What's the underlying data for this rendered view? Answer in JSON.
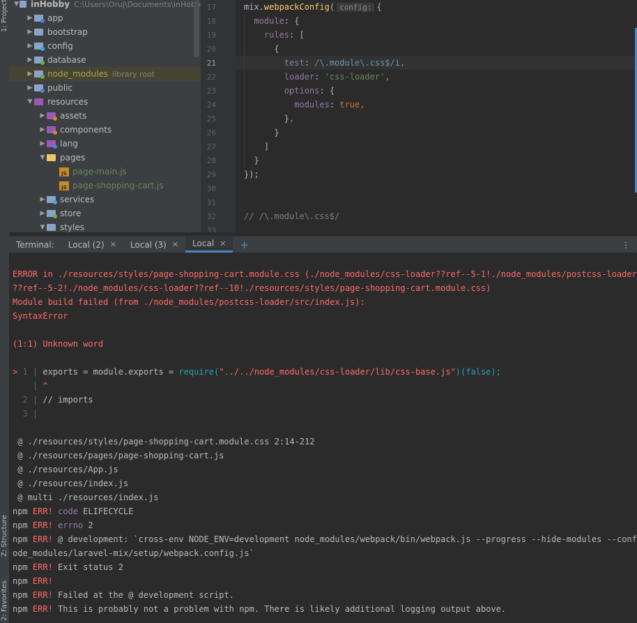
{
  "side_tabs": {
    "project": "1: Project",
    "structure": "Z: Structure",
    "favorites": "2: Favorites"
  },
  "project_tree": [
    {
      "label": "inHobby",
      "path": "C:\\Users\\Oruj\\Documents\\inHobb",
      "level": 0,
      "arrow": "down",
      "type": "root"
    },
    {
      "label": "app",
      "level": 1,
      "arrow": "right",
      "type": "folder"
    },
    {
      "label": "bootstrap",
      "level": 1,
      "arrow": "right",
      "type": "folder"
    },
    {
      "label": "config",
      "level": 1,
      "arrow": "right",
      "type": "folder"
    },
    {
      "label": "database",
      "level": 1,
      "arrow": "right",
      "type": "folder"
    },
    {
      "label": "node_modules",
      "extra": "library root",
      "level": 1,
      "arrow": "right",
      "type": "folder",
      "highlight": true
    },
    {
      "label": "public",
      "level": 1,
      "arrow": "right",
      "type": "folder"
    },
    {
      "label": "resources",
      "level": 1,
      "arrow": "down",
      "type": "folder"
    },
    {
      "label": "assets",
      "level": 2,
      "arrow": "right",
      "type": "folder"
    },
    {
      "label": "components",
      "level": 2,
      "arrow": "right",
      "type": "folder"
    },
    {
      "label": "lang",
      "level": 2,
      "arrow": "right",
      "type": "folder"
    },
    {
      "label": "pages",
      "level": 2,
      "arrow": "down",
      "type": "folder"
    },
    {
      "label": "page-main.js",
      "level": 3,
      "arrow": "",
      "type": "js"
    },
    {
      "label": "page-shopping-cart.js",
      "level": 3,
      "arrow": "",
      "type": "js"
    },
    {
      "label": "services",
      "level": 2,
      "arrow": "right",
      "type": "folder"
    },
    {
      "label": "store",
      "level": 2,
      "arrow": "right",
      "type": "folder"
    },
    {
      "label": "styles",
      "level": 2,
      "arrow": "down",
      "type": "folder"
    }
  ],
  "editor": {
    "line_numbers": [
      "17",
      "18",
      "19",
      "20",
      "21",
      "22",
      "23",
      "24",
      "25",
      "26",
      "27",
      "28",
      "29",
      "30",
      "31",
      "32",
      "33"
    ],
    "param_hint": "config:",
    "lines": [
      [
        {
          "t": "mix.",
          "c": "pl"
        },
        {
          "t": "webpackConfig",
          "c": "fn"
        },
        {
          "t": "(",
          "c": "pl"
        },
        {
          "t": "config:",
          "c": "hint"
        },
        {
          "t": "{",
          "c": "pl"
        }
      ],
      [
        {
          "t": "  module",
          "c": "prop"
        },
        {
          "t": ": {",
          "c": "pl"
        }
      ],
      [
        {
          "t": "    rules",
          "c": "prop"
        },
        {
          "t": ": [",
          "c": "pl"
        }
      ],
      [
        {
          "t": "      {",
          "c": "pl"
        }
      ],
      [
        {
          "t": "        test",
          "c": "prop"
        },
        {
          "t": ": ",
          "c": "pl"
        },
        {
          "t": "/\\.module\\.css$/i",
          "c": "rx"
        },
        {
          "t": ",",
          "c": "kw"
        }
      ],
      [
        {
          "t": "        loader",
          "c": "prop"
        },
        {
          "t": ": ",
          "c": "pl"
        },
        {
          "t": "'css-loader'",
          "c": "str"
        },
        {
          "t": ",",
          "c": "kw"
        }
      ],
      [
        {
          "t": "        options",
          "c": "prop"
        },
        {
          "t": ": {",
          "c": "pl"
        }
      ],
      [
        {
          "t": "          modules",
          "c": "prop"
        },
        {
          "t": ": ",
          "c": "pl"
        },
        {
          "t": "true",
          "c": "kw"
        },
        {
          "t": ",",
          "c": "kw"
        }
      ],
      [
        {
          "t": "        }",
          "c": "pl"
        },
        {
          "t": ",",
          "c": "kw"
        }
      ],
      [
        {
          "t": "      }",
          "c": "pl"
        }
      ],
      [
        {
          "t": "    ]",
          "c": "pl"
        }
      ],
      [
        {
          "t": "  }",
          "c": "pl"
        }
      ],
      [
        {
          "t": "});",
          "c": "pl"
        }
      ],
      [],
      [],
      [
        {
          "t": "// /\\.module\\.css$/",
          "c": "cm"
        }
      ],
      []
    ]
  },
  "terminal": {
    "label": "Terminal:",
    "tabs": [
      {
        "label": "Local (2)",
        "active": false
      },
      {
        "label": "Local (3)",
        "active": false
      },
      {
        "label": "Local",
        "active": true
      }
    ],
    "add": "+",
    "menu": "⋮",
    "lines": [
      {
        "text": "",
        "c": ""
      },
      {
        "text": "ERROR in ./resources/styles/page-shopping-cart.module.css (./node_modules/css-loader??ref--5-1!./node_modules/postcss-loader/src",
        "c": "err"
      },
      {
        "text": "??ref--5-2!./node_modules/css-loader??ref--10!./resources/styles/page-shopping-cart.module.css)",
        "c": "err"
      },
      {
        "text": "Module build failed (from ./node_modules/postcss-loader/src/index.js):",
        "c": "err"
      },
      {
        "text": "SyntaxError",
        "c": "err"
      },
      {
        "text": "",
        "c": ""
      },
      {
        "text": "(1:1) Unknown word",
        "c": "err"
      },
      {
        "text": "",
        "c": ""
      },
      {
        "segments": [
          {
            "t": "> ",
            "c": "err"
          },
          {
            "t": "1 | ",
            "c": "gut"
          },
          {
            "t": "exports = module.exports = ",
            "c": ""
          },
          {
            "t": "require(",
            "c": "cyan"
          },
          {
            "t": "\"../../node_modules/css-loader/lib/css-base.js\"",
            "c": "err"
          },
          {
            "t": ")(false);",
            "c": "cyan"
          }
        ]
      },
      {
        "segments": [
          {
            "t": "    | ",
            "c": "gut"
          },
          {
            "t": "^",
            "c": "err"
          }
        ]
      },
      {
        "segments": [
          {
            "t": "  2 | ",
            "c": "gut"
          },
          {
            "t": "// imports",
            "c": ""
          }
        ]
      },
      {
        "segments": [
          {
            "t": "  3 | ",
            "c": "gut"
          }
        ]
      },
      {
        "text": "",
        "c": ""
      },
      {
        "text": " @ ./resources/styles/page-shopping-cart.module.css 2:14-212",
        "c": ""
      },
      {
        "text": " @ ./resources/pages/page-shopping-cart.js",
        "c": ""
      },
      {
        "text": " @ ./resources/App.js",
        "c": ""
      },
      {
        "text": " @ ./resources/index.js",
        "c": ""
      },
      {
        "text": " @ multi ./resources/index.js",
        "c": ""
      },
      {
        "segments": [
          {
            "t": "npm ",
            "c": ""
          },
          {
            "t": "ERR!",
            "c": "err"
          },
          {
            "t": " ",
            "c": ""
          },
          {
            "t": "code",
            "c": "prop"
          },
          {
            "t": " ELIFECYCLE",
            "c": ""
          }
        ]
      },
      {
        "segments": [
          {
            "t": "npm ",
            "c": ""
          },
          {
            "t": "ERR!",
            "c": "err"
          },
          {
            "t": " ",
            "c": ""
          },
          {
            "t": "errno",
            "c": "prop"
          },
          {
            "t": " 2",
            "c": ""
          }
        ]
      },
      {
        "segments": [
          {
            "t": "npm ",
            "c": ""
          },
          {
            "t": "ERR!",
            "c": "err"
          },
          {
            "t": " @ development: `cross-env NODE_ENV=development node_modules/webpack/bin/webpack.js --progress --hide-modules --config=n",
            "c": ""
          }
        ]
      },
      {
        "text": "ode_modules/laravel-mix/setup/webpack.config.js`",
        "c": ""
      },
      {
        "segments": [
          {
            "t": "npm ",
            "c": ""
          },
          {
            "t": "ERR!",
            "c": "err"
          },
          {
            "t": " Exit status 2",
            "c": ""
          }
        ]
      },
      {
        "segments": [
          {
            "t": "npm ",
            "c": ""
          },
          {
            "t": "ERR!",
            "c": "err"
          }
        ]
      },
      {
        "segments": [
          {
            "t": "npm ",
            "c": ""
          },
          {
            "t": "ERR!",
            "c": "err"
          },
          {
            "t": " Failed at the @ development script.",
            "c": ""
          }
        ]
      },
      {
        "segments": [
          {
            "t": "npm ",
            "c": ""
          },
          {
            "t": "ERR!",
            "c": "err"
          },
          {
            "t": " This is probably not a problem with npm. There is likely additional logging output above.",
            "c": ""
          }
        ]
      }
    ]
  },
  "colors": {
    "accent": "#4a88c7",
    "error": "#ff6b68",
    "folder": "#8aa4c8"
  }
}
